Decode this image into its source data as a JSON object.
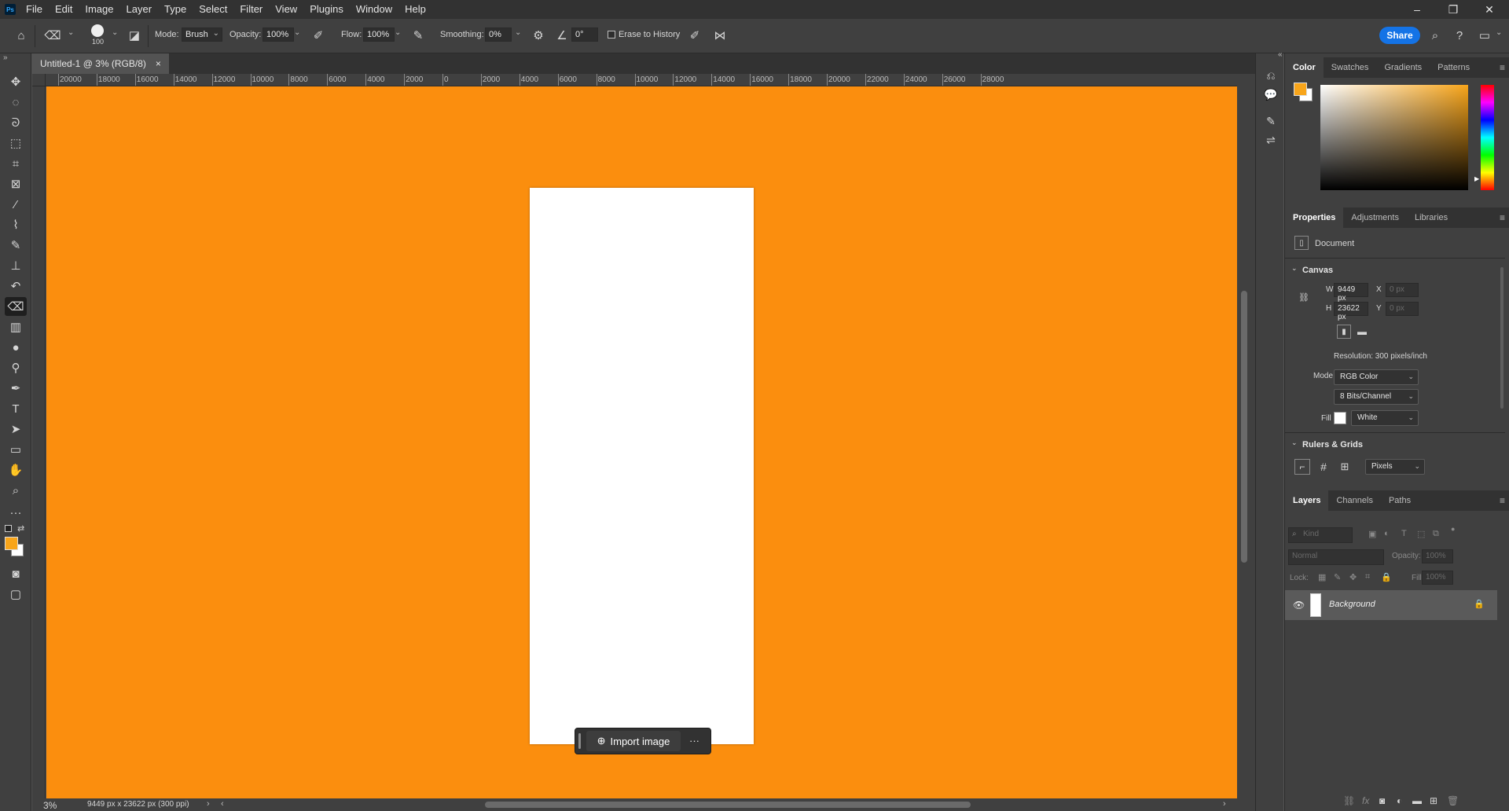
{
  "menu": {
    "logo": "Ps",
    "items": [
      "File",
      "Edit",
      "Image",
      "Layer",
      "Type",
      "Select",
      "Filter",
      "View",
      "Plugins",
      "Window",
      "Help"
    ]
  },
  "window_controls": {
    "minimize": "–",
    "restore": "❐",
    "close": "✕"
  },
  "options": {
    "brush_size": "100",
    "mode_label": "Mode:",
    "mode_value": "Brush",
    "opacity_label": "Opacity:",
    "opacity_value": "100%",
    "flow_label": "Flow:",
    "flow_value": "100%",
    "smoothing_label": "Smoothing:",
    "smoothing_value": "0%",
    "angle_value": "0°",
    "erase_history_label": "Erase to History",
    "share_label": "Share"
  },
  "document": {
    "tab_title": "Untitled-1 @ 3% (RGB/8)",
    "tab_close": "×",
    "zoom": "3%",
    "status": "9449 px x 23622 px (300 ppi)",
    "canvas_color": "#fb8e0e",
    "import_label": "Import image",
    "more": "···"
  },
  "rulers": {
    "h_ticks": [
      "20000",
      "18000",
      "16000",
      "14000",
      "12000",
      "10000",
      "8000",
      "6000",
      "4000",
      "2000",
      "0",
      "2000",
      "4000",
      "6000",
      "8000",
      "10000",
      "12000",
      "14000",
      "16000",
      "18000",
      "20000",
      "22000",
      "24000",
      "26000",
      "28000"
    ]
  },
  "color_panel": {
    "tabs": [
      "Color",
      "Swatches",
      "Gradients",
      "Patterns"
    ],
    "foreground": "#f8a51a",
    "background": "#ffffff"
  },
  "properties": {
    "tabs": [
      "Properties",
      "Adjustments",
      "Libraries"
    ],
    "doc_label": "Document",
    "canvas_section": "Canvas",
    "w_label": "W",
    "w_value": "9449 px",
    "h_label": "H",
    "h_value": "23622 px",
    "x_label": "X",
    "x_value": "0 px",
    "y_label": "Y",
    "y_value": "0 px",
    "resolution": "Resolution: 300 pixels/inch",
    "mode_label": "Mode",
    "mode_value": "RGB Color",
    "bits_value": "8 Bits/Channel",
    "fill_label": "Fill",
    "fill_value": "White",
    "rulers_section": "Rulers & Grids",
    "units_value": "Pixels"
  },
  "layers": {
    "tabs": [
      "Layers",
      "Channels",
      "Paths"
    ],
    "kind_placeholder": "Kind",
    "blend_mode": "Normal",
    "opacity_label": "Opacity:",
    "opacity_value": "100%",
    "lock_label": "Lock:",
    "fill_label": "Fill:",
    "fill_value": "100%",
    "items": [
      {
        "name": "Background"
      }
    ]
  }
}
